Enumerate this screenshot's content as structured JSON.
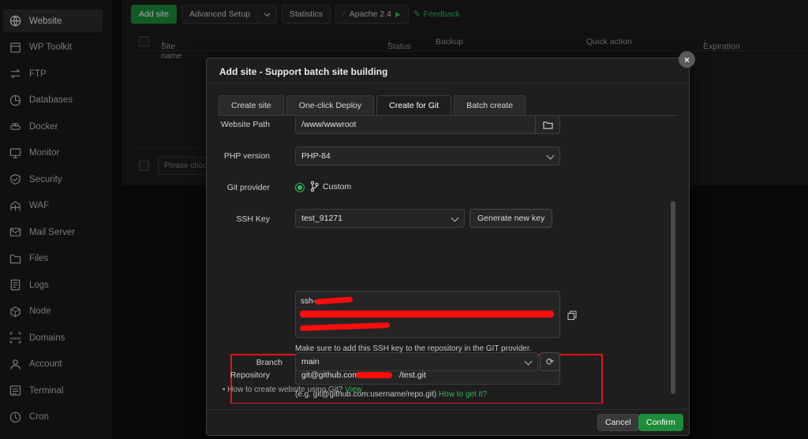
{
  "sidebar": {
    "items": [
      {
        "label": "Website",
        "icon": "globe-icon",
        "active": true
      },
      {
        "label": "WP Toolkit",
        "icon": "wordpress-icon"
      },
      {
        "label": "FTP",
        "icon": "transfer-icon"
      },
      {
        "label": "Databases",
        "icon": "database-icon"
      },
      {
        "label": "Docker",
        "icon": "docker-icon"
      },
      {
        "label": "Monitor",
        "icon": "monitor-icon"
      },
      {
        "label": "Security",
        "icon": "shield-icon"
      },
      {
        "label": "WAF",
        "icon": "firewall-icon"
      },
      {
        "label": "Mail Server",
        "icon": "mail-icon"
      },
      {
        "label": "Files",
        "icon": "folder-icon"
      },
      {
        "label": "Logs",
        "icon": "log-icon"
      },
      {
        "label": "Node",
        "icon": "node-icon"
      },
      {
        "label": "Domains",
        "icon": "domain-icon"
      },
      {
        "label": "Account",
        "icon": "user-icon"
      },
      {
        "label": "Terminal",
        "icon": "terminal-icon"
      },
      {
        "label": "Cron",
        "icon": "clock-icon"
      }
    ]
  },
  "toolbar": {
    "add_site": "Add site",
    "advanced_setup": "Advanced Setup",
    "statistics": "Statistics",
    "apache": "Apache 2.4",
    "feedback": "Feedback"
  },
  "table": {
    "columns": [
      "Site name",
      "Status",
      "Backup",
      "Quick action",
      "Expiration"
    ],
    "choose_placeholder": "Please choo"
  },
  "modal": {
    "title": "Add site - Support batch site building",
    "tabs": [
      "Create site",
      "One-click Deploy",
      "Create for Git",
      "Batch create"
    ],
    "active_tab": "Create for Git",
    "website_path": {
      "label": "Website Path",
      "value": "/www/wwwroot"
    },
    "php_version": {
      "label": "PHP version",
      "value": "PHP-84"
    },
    "git_provider": {
      "label": "Git provider",
      "value": "Custom"
    },
    "ssh_key": {
      "label": "SSH Key",
      "value": "test_91271",
      "generate_button": "Generate new key"
    },
    "ssh_key_text": "ssh-",
    "ssh_hint": "Make sure to add this SSH key to the repository in the GIT provider.",
    "repository": {
      "label": "Repository",
      "value_prefix": "git@github.com:",
      "value_suffix": "/test.git"
    },
    "repo_example": "(e.g. git@github.com:username/repo.git)",
    "repo_help_link": "How to get it?",
    "branch": {
      "label": "Branch",
      "value": "main"
    },
    "help_text": "How to create website using Git?",
    "help_link": "View",
    "cancel": "Cancel",
    "confirm": "Confirm"
  },
  "colors": {
    "accent": "#1e8c3a",
    "link": "#2fb956",
    "redaction": "#ff0c0c",
    "highlight_border": "#e31414"
  }
}
